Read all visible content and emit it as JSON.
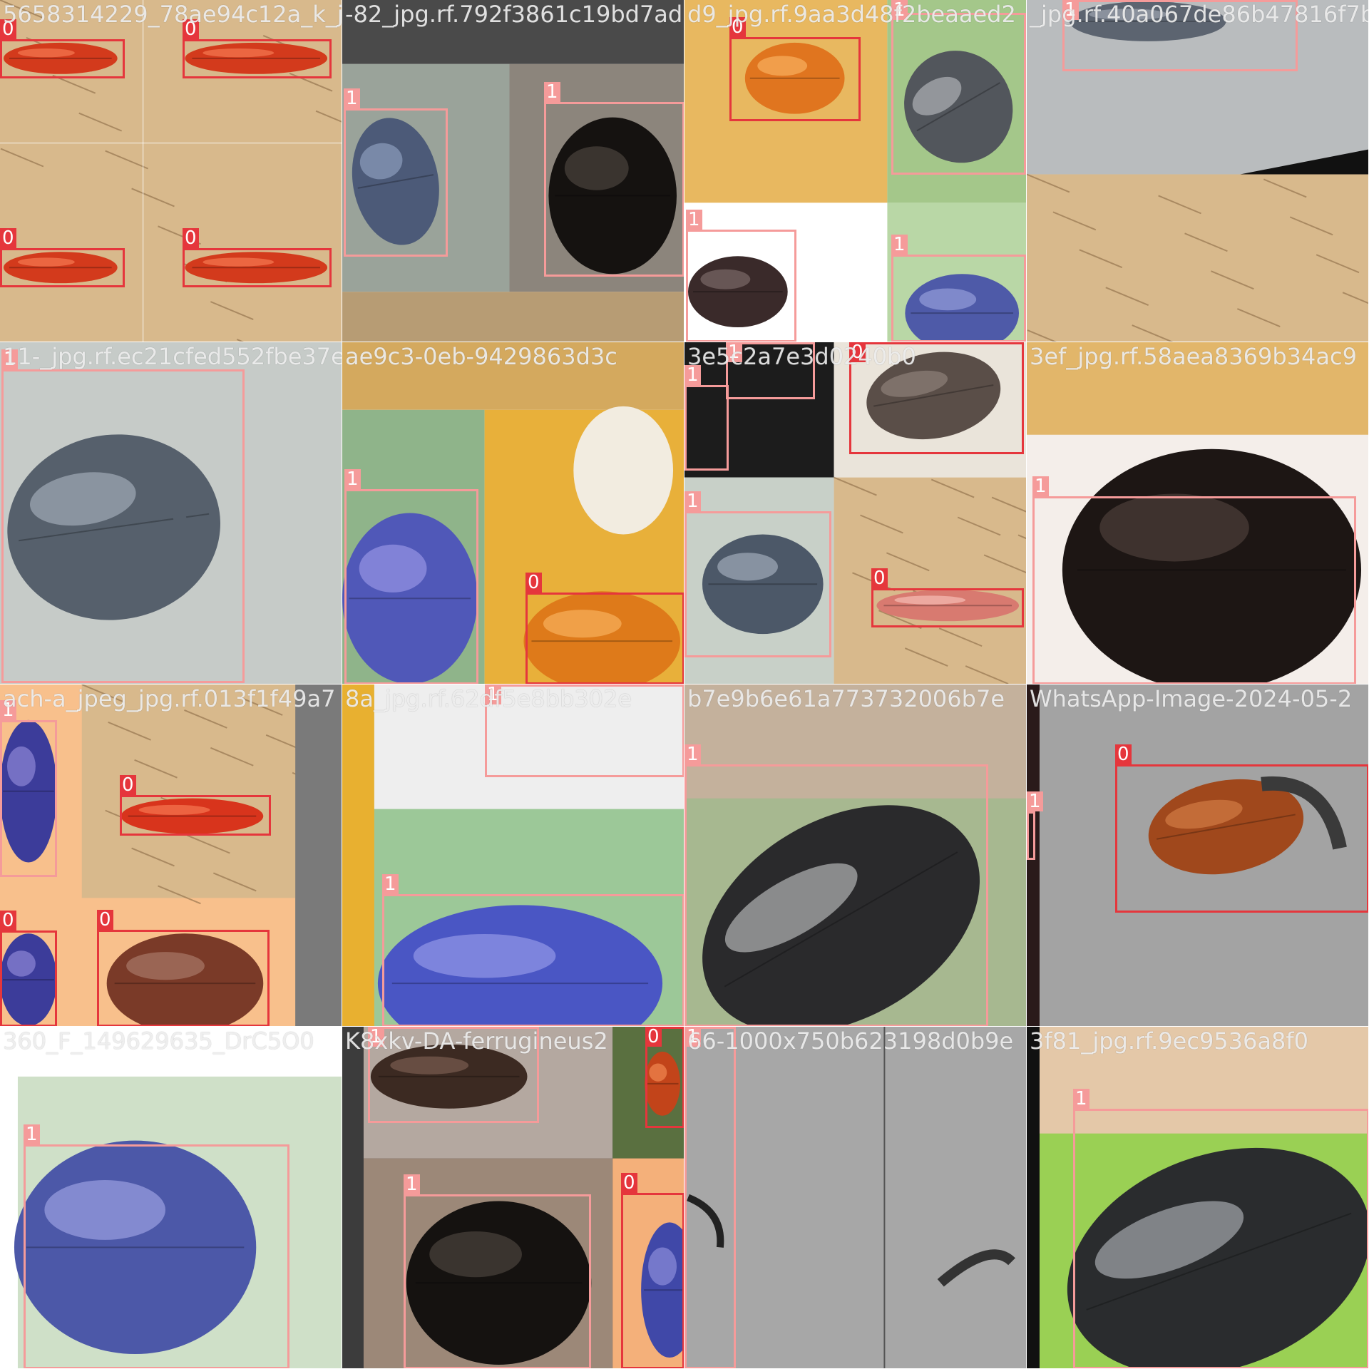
{
  "colors": {
    "class0": "#e5363c",
    "class1": "#f59b9a"
  },
  "tiles": [
    {
      "filename": "565831422​9_78ae94c12a_k_jpg.rf.3c",
      "scene": "straw-red-beetles",
      "labels": [
        {
          "cls": "0"
        },
        {
          "cls": "0"
        },
        {
          "cls": "0"
        },
        {
          "cls": "0"
        }
      ]
    },
    {
      "filename": "-82_jpg.rf.792f3861c19bd7ada",
      "scene": "grey-beetle-dark",
      "labels": [
        {
          "cls": "1"
        },
        {
          "cls": "1"
        }
      ]
    },
    {
      "filename": "d9_jpg.rf.9aa3d48f2beaaed2",
      "scene": "orange-weevil-mix",
      "labels": [
        {
          "cls": "0"
        },
        {
          "cls": "1"
        },
        {
          "cls": "1"
        },
        {
          "cls": "1"
        }
      ]
    },
    {
      "filename": "_jpg.rf.40a067de86b47816f7b9",
      "scene": "grey-straw",
      "labels": [
        {
          "cls": "1"
        }
      ]
    },
    {
      "filename": "11-_jpg.rf.ec21cfed552fbe37e8",
      "scene": "grey-rhino",
      "labels": [
        {
          "cls": "1"
        }
      ]
    },
    {
      "filename": "ae9c3-0eb-9429863d3c",
      "scene": "blue-orange",
      "labels": [
        {
          "cls": "1"
        },
        {
          "cls": "0"
        }
      ]
    },
    {
      "filename": "3e5c2a7e3d0240b0",
      "scene": "mixed-collage",
      "labels": [
        {
          "cls": "1"
        },
        {
          "cls": "1"
        },
        {
          "cls": "0"
        },
        {
          "cls": "1"
        },
        {
          "cls": "0"
        }
      ]
    },
    {
      "filename": "3ef_jpg.rf.58aea8369b34ac9",
      "scene": "fuzzy-beetle",
      "labels": [
        {
          "cls": "1"
        }
      ]
    },
    {
      "filename": "ach-a_jpeg_jpg.rf.013f1f49a7",
      "scene": "orange-beetles",
      "labels": [
        {
          "cls": "1"
        },
        {
          "cls": "0"
        },
        {
          "cls": "0"
        },
        {
          "cls": "0"
        }
      ]
    },
    {
      "filename": "8a_jpg.rf.62df5e8bb302e",
      "scene": "blue-green",
      "labels": [
        {
          "cls": "1"
        },
        {
          "cls": "1"
        }
      ]
    },
    {
      "filename": "b7e9b6e61a773732006b7e",
      "scene": "silver-underside",
      "labels": [
        {
          "cls": "1"
        }
      ]
    },
    {
      "filename": "WhatsApp-Image-2024-05-2",
      "scene": "weevil-grey",
      "labels": [
        {
          "cls": "0"
        },
        {
          "cls": "1"
        }
      ]
    },
    {
      "filename": "360_F_149629635_DrC5O0",
      "scene": "blue-rhino",
      "labels": [
        {
          "cls": "1"
        }
      ]
    },
    {
      "filename": "K8xkv-DA-ferrugineus2",
      "scene": "dark-collage",
      "labels": [
        {
          "cls": "1"
        },
        {
          "cls": "0"
        },
        {
          "cls": "1"
        },
        {
          "cls": "0"
        }
      ]
    },
    {
      "filename": "66-1000x750b623198d0b9e",
      "scene": "grey-horn",
      "labels": [
        {
          "cls": "1"
        }
      ]
    },
    {
      "filename": "3f81_jpg.rf.9ec9536a8f0",
      "scene": "green-underside",
      "labels": [
        {
          "cls": "1"
        }
      ]
    }
  ]
}
